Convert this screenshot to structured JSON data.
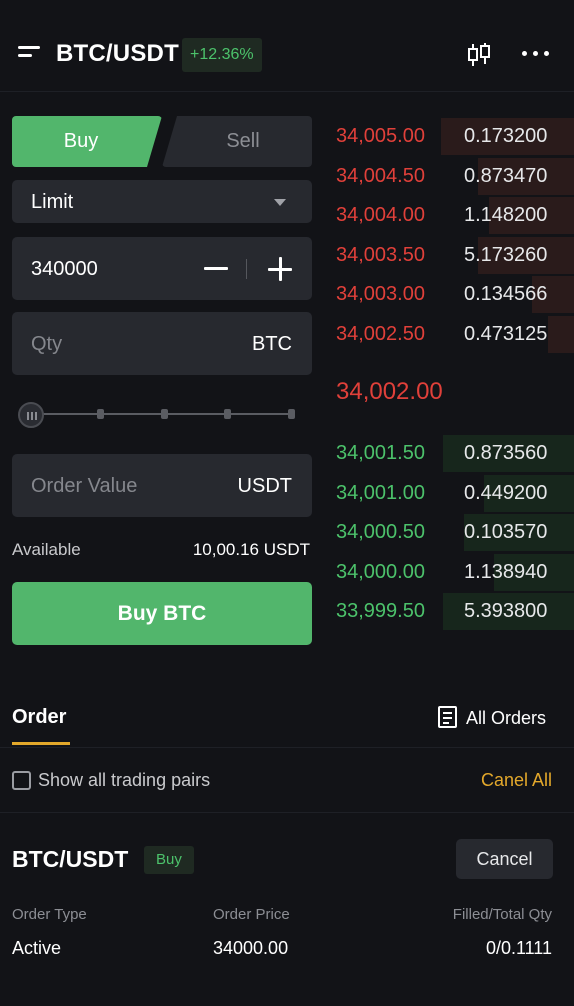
{
  "header": {
    "pair": "BTC/USDT",
    "change": "+12.36%",
    "menu_icon": "menu-icon",
    "chart_icon": "candlestick-icon",
    "more_icon": "more-icon"
  },
  "trade_form": {
    "tabs": {
      "buy": "Buy",
      "sell": "Sell",
      "active": "Buy"
    },
    "order_type": "Limit",
    "price": "340000",
    "qty_placeholder": "Qty",
    "qty_unit": "BTC",
    "slider_level_percent": 0,
    "order_value_placeholder": "Order Value",
    "order_value_unit": "USDT",
    "available_label": "Available",
    "available_value": "10,00.16 USDT",
    "submit_label": "Buy BTC"
  },
  "order_book": {
    "asks": [
      {
        "price": "34,005.00",
        "qty": "0.173200"
      },
      {
        "price": "34,004.50",
        "qty": "0.873470"
      },
      {
        "price": "34,004.00",
        "qty": "1.148200"
      },
      {
        "price": "34,003.50",
        "qty": "5.173260"
      },
      {
        "price": "34,003.00",
        "qty": "0.134566"
      },
      {
        "price": "34,002.50",
        "qty": "0.473125"
      }
    ],
    "last_price": "34,002.00",
    "bids": [
      {
        "price": "34,001.50",
        "qty": "0.873560"
      },
      {
        "price": "34,001.00",
        "qty": "0.449200"
      },
      {
        "price": "34,000.50",
        "qty": "0.103570"
      },
      {
        "price": "34,000.00",
        "qty": "1.138940"
      },
      {
        "price": "33,999.50",
        "qty": "5.393800"
      }
    ]
  },
  "orders": {
    "tab": "Order",
    "all_orders": "All Orders",
    "show_all_pairs": "Show all trading pairs",
    "cancel_all": "Canel All",
    "card": {
      "pair": "BTC/USDT",
      "side": "Buy",
      "cancel": "Cancel",
      "col_type": "Order Type",
      "col_price": "Order Price",
      "col_filled": "Filled/Total Qty",
      "type_value": "Active",
      "price_value": "34000.00",
      "filled_value": "0/0.1111"
    }
  },
  "colors": {
    "background": "#121317",
    "buy": "#52b66c",
    "bid_text": "#4cc26b",
    "ask_text": "#e0403a",
    "accent": "#e3a82b",
    "field_bg": "#27292f"
  }
}
